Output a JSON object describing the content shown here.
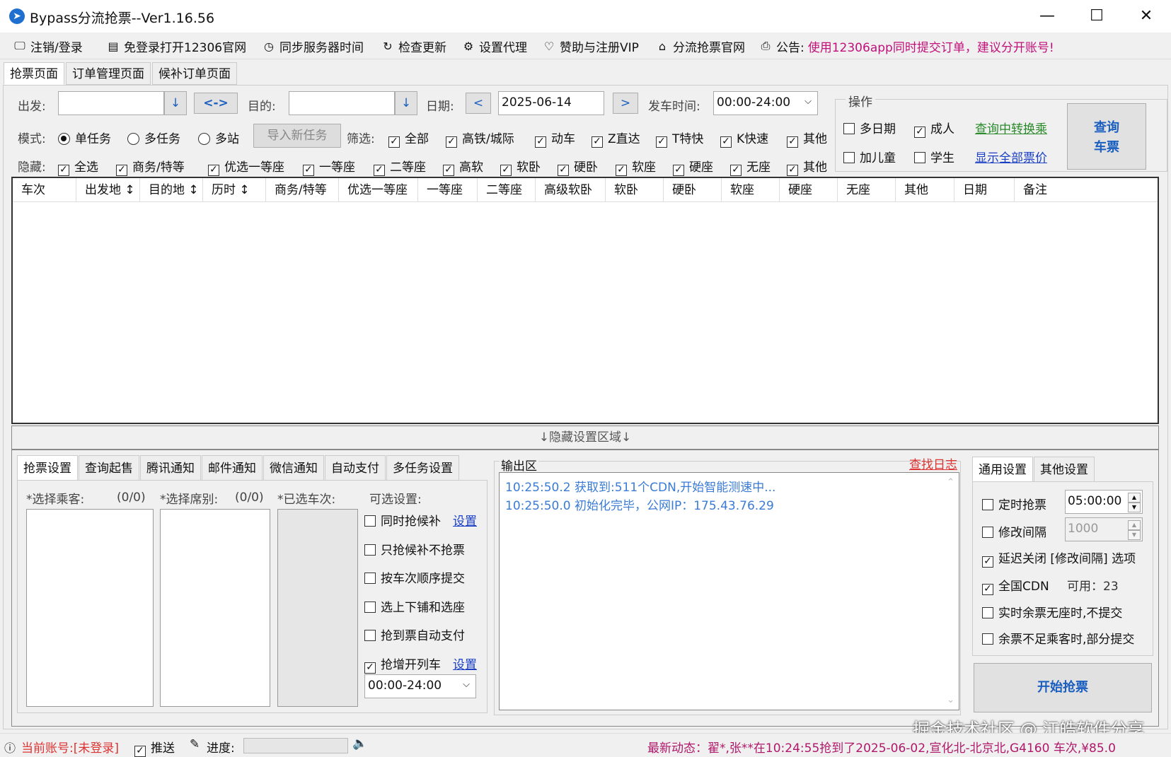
{
  "window": {
    "title": "Bypass分流抢票--Ver1.16.56",
    "icon": "app-logo-icon"
  },
  "toolbar": {
    "items": [
      "注销/登录",
      "免登录打开12306官网",
      "同步服务器时间",
      "检查更新",
      "设置代理",
      "赞助与注册VIP",
      "分流抢票官网",
      "公告:"
    ],
    "notice": "使用12306app同时提交订单，建议分开账号!"
  },
  "tabs": [
    "抢票页面",
    "订单管理页面",
    "候补订单页面"
  ],
  "search": {
    "from_label": "出发:",
    "from_value": "",
    "swap_label": "<->",
    "to_label": "目的:",
    "to_value": "",
    "date_label": "日期:",
    "date_value": "2025-06-14",
    "prev": "<",
    "next": ">",
    "depart_label": "发车时间:",
    "depart_value": "00:00-24:00"
  },
  "mode": {
    "label": "模式:",
    "options": [
      "单任务",
      "多任务",
      "多站"
    ],
    "selected": 0,
    "import_btn": "导入新任务"
  },
  "filter": {
    "label": "筛选:",
    "items": [
      "全部",
      "高铁/城际",
      "动车",
      "Z直达",
      "T特快",
      "K快速",
      "其他"
    ]
  },
  "hide": {
    "label": "隐藏:",
    "items": [
      "全选",
      "商务/特等",
      "优选一等座",
      "一等座",
      "二等座",
      "高软",
      "软卧",
      "硬卧",
      "软座",
      "硬座",
      "无座",
      "其他"
    ]
  },
  "ops": {
    "title": "操作",
    "multi_date": "多日期",
    "adult": "成人",
    "add_child": "加儿童",
    "student": "学生",
    "transfer_link": "查询中转换乘",
    "all_price_link": "显示全部票价",
    "query_btn_1": "查询",
    "query_btn_2": "车票"
  },
  "table": {
    "columns": [
      "车次",
      "出发地 ↕",
      "目的地 ↕",
      "历时 ↕",
      "商务/特等",
      "优选一等座",
      "一等座",
      "二等座",
      "高级软卧",
      "软卧",
      "硬卧",
      "软座",
      "硬座",
      "无座",
      "其他",
      "日期",
      "备注"
    ],
    "rows": []
  },
  "hidden_area": "↓隐藏设置区域↓",
  "bottom_tabs": [
    "抢票设置",
    "查询起售",
    "腾讯通知",
    "邮件通知",
    "微信通知",
    "自动支付",
    "多任务设置"
  ],
  "passenger": {
    "label": "*选择乘客:",
    "count": "(0/0)"
  },
  "seat": {
    "label": "*选择席别:",
    "count": "(0/0)"
  },
  "trains": {
    "label": "*已选车次:"
  },
  "optional": {
    "label": "可选设置:",
    "items": [
      "同时抢候补",
      "只抢候补不抢票",
      "按车次顺序提交",
      "选上下铺和选座",
      "抢到票自动支付",
      "抢增开列车"
    ],
    "link": "设置",
    "time_range": "00:00-24:00"
  },
  "output": {
    "title": "输出区",
    "log_link": "查找日志",
    "lines": [
      "10:25:50.2  获取到:511个CDN,开始智能测速中...",
      "10:25:50.0  初始化完毕，公网IP：175.43.76.29"
    ]
  },
  "general": {
    "tabs": [
      "通用设置",
      "其他设置"
    ],
    "timed": "定时抢票",
    "timed_value": "05:00:00",
    "interval": "修改间隔",
    "interval_value": "1000",
    "delay_close": "延迟关闭 [修改间隔] 选项",
    "cdn": "全国CDN",
    "cdn_avail": "可用：23",
    "opt1": "实时余票无座时,不提交",
    "opt2": "余票不足乘客时,部分提交",
    "start_btn": "开始抢票"
  },
  "status": {
    "account": "当前账号:[未登录]",
    "push": "推送",
    "progress": "进度:",
    "news": "最新动态：翟*,张**在10:24:55抢到了2025-06-02,宣化北-北京北,G4160 车次,¥85.0"
  },
  "watermark": "掘金技术社区 @ 江皓软件分享"
}
